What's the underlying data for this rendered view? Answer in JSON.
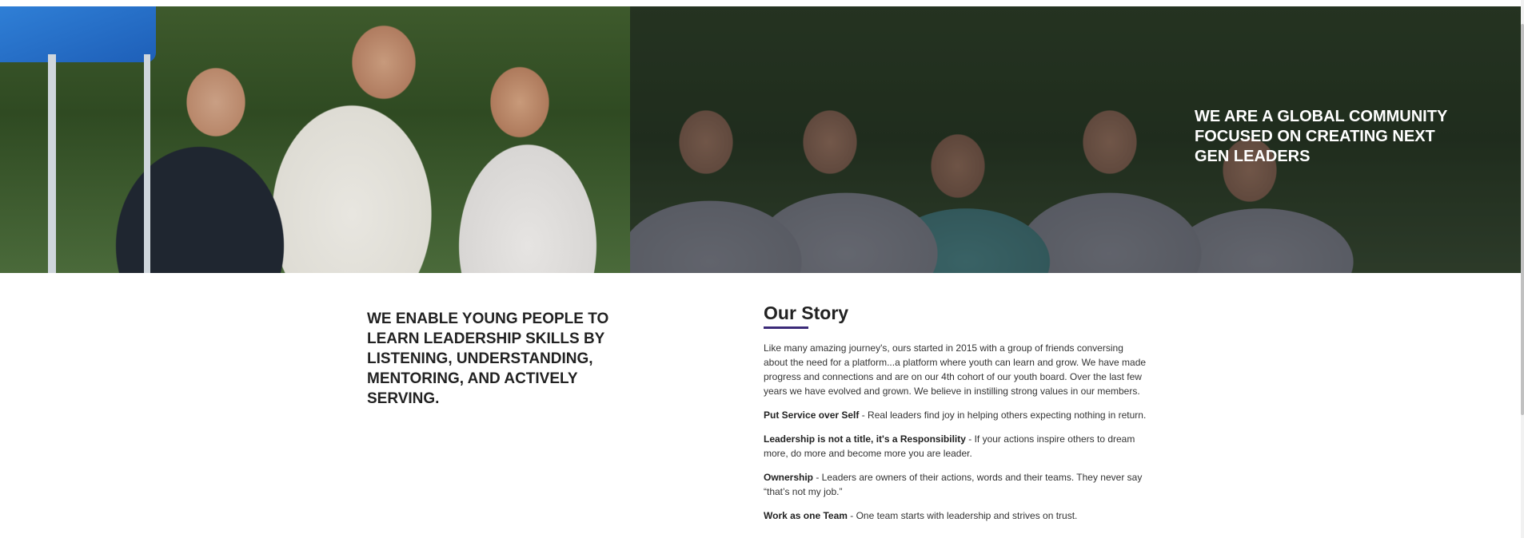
{
  "hero": {
    "tagline": "WE ARE A GLOBAL COMMUNITY FOCUSED ON CREATING NEXT GEN LEADERS"
  },
  "mission": {
    "text": "WE ENABLE YOUNG PEOPLE TO LEARN LEADERSHIP SKILLS BY LISTENING, UNDERSTANDING, MENTORING, AND ACTIVELY SERVING."
  },
  "story": {
    "title": "Our Story",
    "intro": "Like many amazing journey's, ours started in 2015 with a group of friends conversing about the need for a platform...a platform where youth can learn and grow. We have made progress and connections and are on our 4th cohort of our youth board. Over the last few years we have evolved and grown. We believe in instilling strong values in our members.",
    "values": [
      {
        "title": "Put Service over Self",
        "text": " - Real leaders find joy in helping others expecting nothing in return."
      },
      {
        "title": "Leadership is not a title, it's a Responsibility",
        "text": " - If your actions inspire others to dream more, do more and become more you are leader."
      },
      {
        "title": "Ownership",
        "text": " - Leaders are owners of their actions, words and their teams. They never say “that’s not my job.”"
      },
      {
        "title": "Work as one Team",
        "text": " - One team starts with leadership and strives on trust."
      }
    ]
  },
  "colors": {
    "accent_underline": "#3b2a78",
    "heading_text": "#222222",
    "hero_text": "#ffffff"
  }
}
